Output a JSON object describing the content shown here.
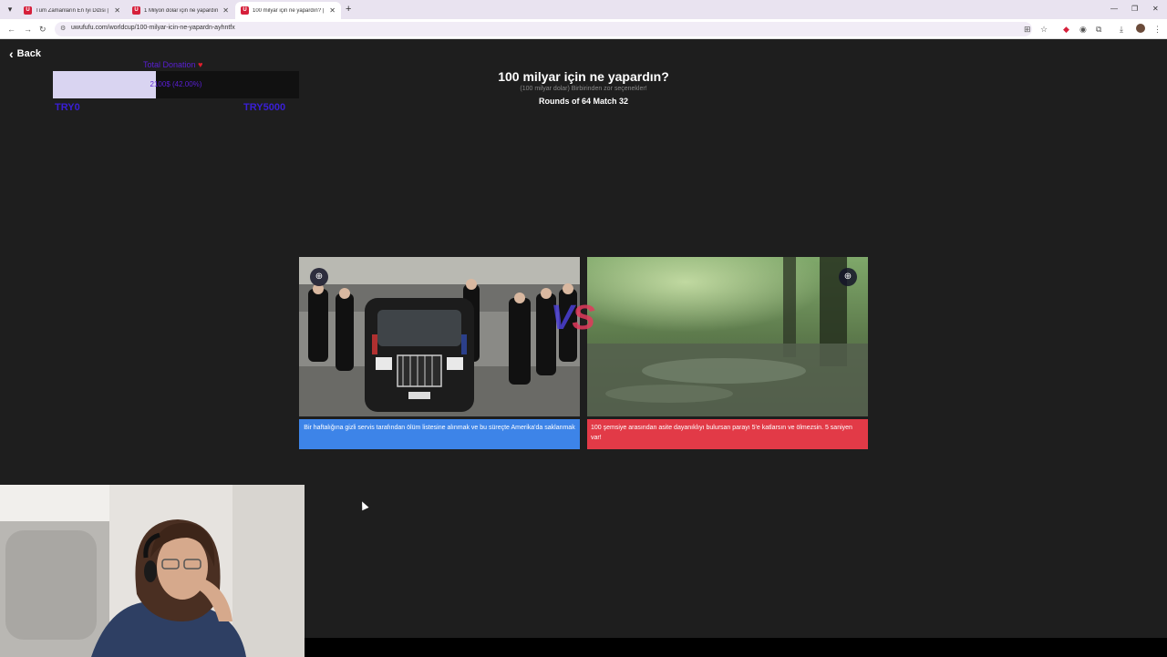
{
  "browser": {
    "tabs": [
      {
        "title": "Tüm Zamanların En İyi Dizisi | U",
        "active": false
      },
      {
        "title": "1 Milyon dolar için ne yapardın",
        "active": false
      },
      {
        "title": "100 milyar için ne yapardın? | U",
        "active": true
      }
    ],
    "url": "uwufufu.com/worldcup/100-milyar-icin-ne-yapardn-ayhntfx",
    "favicon_letter": "U"
  },
  "page": {
    "back_label": "Back",
    "stats": {
      "name": "Total Donation",
      "value_text": "2100$ (42.00%)",
      "fill_fraction": 0.42,
      "min_label": "TRY0",
      "max_label": "TRY5000"
    },
    "title": "100 milyar için ne yapardın?",
    "subtitle": "(100 milyar dolar) Birbirinden zor seçenekler!",
    "round_text": "Rounds of 64 Match 32",
    "vs_v": "V",
    "vs_s": "S",
    "left_choice": {
      "caption": "Bir haftalığına gizli servis tarafından ölüm listesine alınmak ve bu süreçte Amerika'da saklanmak",
      "color": "#3d84e8"
    },
    "right_choice": {
      "caption": "100 şemsiye arasından asite dayanıklıyı bulursan parayı 5'e katlarsın ve ölmezsin. 5 saniyen var!",
      "color": "#e23a47"
    }
  },
  "colors": {
    "page_bg": "#1e1e1e",
    "accent_purple": "#5a1fd6",
    "vs_blue": "#4b3fd4",
    "vs_red": "#e23a5c"
  }
}
